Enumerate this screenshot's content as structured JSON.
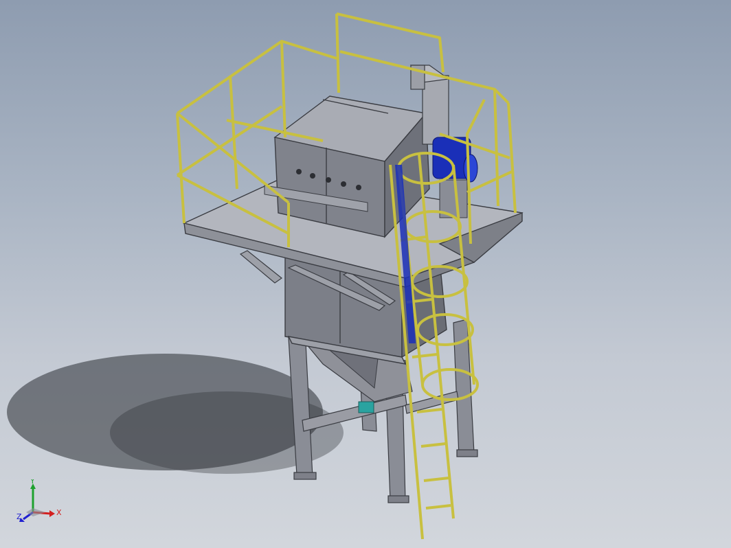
{
  "viewport": {
    "background_top": "#8e9cb0",
    "background_bottom": "#d2d6dc"
  },
  "model": {
    "handrail_color": "#c8c040",
    "steel_color": "#8a8d96",
    "motor_color": "#1a2fb8",
    "valve_color": "#2aa3a0"
  },
  "triad": {
    "y_label": "Y",
    "x_label": "X",
    "z_label": "Z",
    "y_color": "#1ea12e",
    "x_color": "#d32020",
    "z_color": "#2020d0"
  }
}
